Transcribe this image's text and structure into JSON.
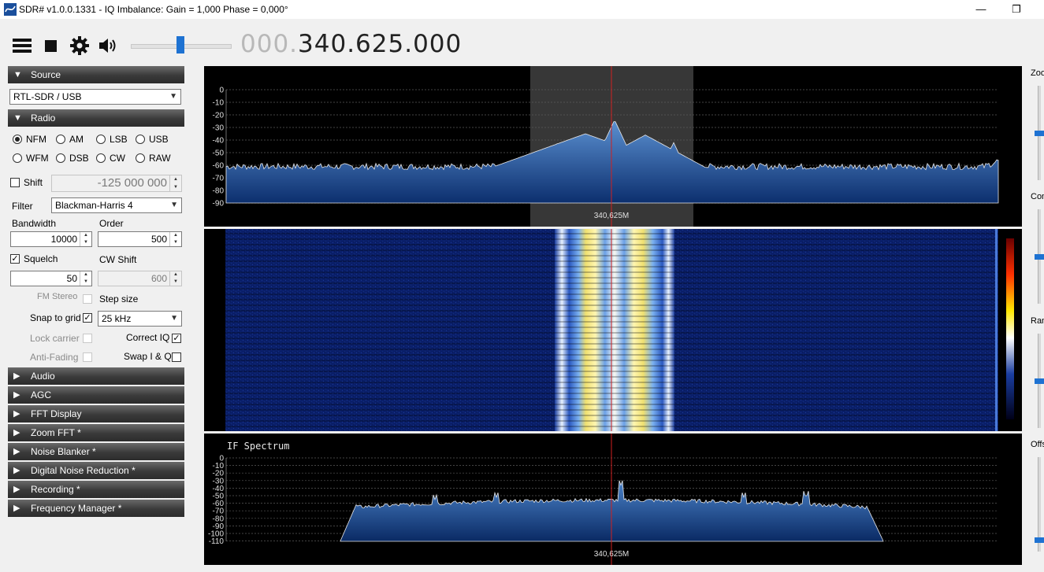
{
  "window": {
    "title": "SDR# v1.0.0.1331 - IQ Imbalance: Gain = 1,000 Phase = 0,000°",
    "minimize_glyph": "—",
    "restore_glyph": "❐"
  },
  "toolbar": {
    "icons": [
      "menu-icon",
      "stop-icon",
      "settings-gear-icon",
      "speaker-icon"
    ],
    "audio_gain_level": 0.5,
    "frequency_dim": "000.",
    "frequency_main": "340.625.000"
  },
  "panels": {
    "source": {
      "title": "Source",
      "device": "RTL-SDR / USB"
    },
    "radio": {
      "title": "Radio",
      "modes": [
        "NFM",
        "AM",
        "LSB",
        "USB",
        "WFM",
        "DSB",
        "CW",
        "RAW"
      ],
      "selected_mode": "NFM",
      "shift_label": "Shift",
      "shift_checked": false,
      "shift_value": "-125 000 000",
      "filter_label": "Filter",
      "filter_value": "Blackman-Harris 4",
      "bandwidth_label": "Bandwidth",
      "bandwidth_value": "10000",
      "order_label": "Order",
      "order_value": "500",
      "squelch_label": "Squelch",
      "squelch_checked": true,
      "squelch_value": "50",
      "cw_shift_label": "CW Shift",
      "cw_shift_value": "600",
      "fm_stereo_label": "FM Stereo",
      "fm_stereo_checked": false,
      "step_size_label": "Step size",
      "snap_to_grid_label": "Snap to grid",
      "snap_to_grid_checked": true,
      "step_size_value": "25 kHz",
      "lock_carrier_label": "Lock carrier",
      "lock_carrier_checked": false,
      "correct_iq_label": "Correct IQ",
      "correct_iq_checked": true,
      "anti_fading_label": "Anti-Fading",
      "anti_fading_checked": false,
      "swap_iq_label": "Swap I & Q",
      "swap_iq_checked": false
    },
    "collapsed": [
      "Audio",
      "AGC",
      "FFT Display",
      "Zoom FFT *",
      "Noise Blanker *",
      "Digital Noise Reduction *",
      "Recording *",
      "Frequency Manager *"
    ]
  },
  "spectrum": {
    "db_ticks": [
      "0",
      "-10",
      "-20",
      "-30",
      "-40",
      "-50",
      "-60",
      "-70",
      "-80",
      "-90"
    ],
    "center_label": "340,625M"
  },
  "if_spectrum": {
    "title": "IF Spectrum",
    "db_ticks": [
      "0",
      "-10",
      "-20",
      "-30",
      "-40",
      "-50",
      "-60",
      "-70",
      "-80",
      "-90",
      "-100",
      "-110"
    ],
    "center_label": "340,625M"
  },
  "right_sliders": [
    {
      "label": "Zoo",
      "level": 0.5
    },
    {
      "label": "Con",
      "level": 0.5
    },
    {
      "label": "Ran",
      "level": 0.5
    },
    {
      "label": "Offs",
      "level": 0.1
    }
  ],
  "colors": {
    "header_gradient_top": "#6a6a6a",
    "header_gradient_bottom": "#2c2c2c",
    "accent_blue": "#1e72d2",
    "center_line": "#d02020",
    "spectrum_fill": "#2a5fa8"
  }
}
